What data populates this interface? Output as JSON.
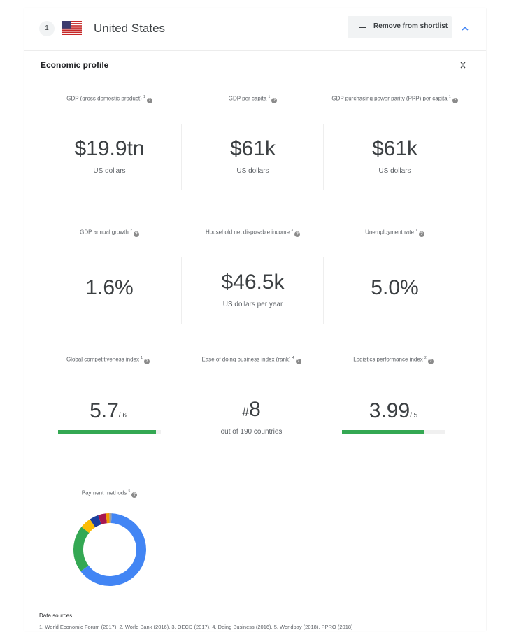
{
  "header": {
    "rank": "1",
    "country": "United States",
    "remove_label": "Remove from shortlist"
  },
  "section": {
    "title": "Economic profile"
  },
  "metrics": {
    "gdp": {
      "label": "GDP (gross domestic product)",
      "sup": "1",
      "value": "$19.9tn",
      "unit": "US dollars"
    },
    "gdp_per_capita": {
      "label": "GDP per capita",
      "sup": "1",
      "value": "$61k",
      "unit": "US dollars"
    },
    "gdp_ppp": {
      "label": "GDP purchasing power parity (PPP) per capita",
      "sup": "1",
      "value": "$61k",
      "unit": "US dollars"
    },
    "gdp_growth": {
      "label": "GDP annual growth",
      "sup": "2",
      "value": "1.6%"
    },
    "household_income": {
      "label": "Household net disposable income",
      "sup": "3",
      "value": "$46.5k",
      "unit": "US dollars per year"
    },
    "unemployment": {
      "label": "Unemployment rate",
      "sup": "1",
      "value": "5.0%"
    },
    "competitiveness": {
      "label": "Global competitiveness index",
      "sup": "1",
      "value": "5.7",
      "denominator": "/ 6",
      "fraction": 0.95
    },
    "ease_business": {
      "label": "Ease of doing business index (rank)",
      "sup": "4",
      "hash": "#",
      "value": "8",
      "unit": "out of 190 countries"
    },
    "logistics": {
      "label": "Logistics performance index",
      "sup": "2",
      "value": "3.99",
      "denominator": "/ 5",
      "fraction": 0.8
    },
    "payment": {
      "label": "Payment methods",
      "sup": "5"
    }
  },
  "payment_segments": [
    {
      "share": 0.64,
      "color": "#4285f4"
    },
    {
      "share": 0.21,
      "color": "#34a853"
    },
    {
      "share": 0.05,
      "color": "#fbbc04"
    },
    {
      "share": 0.04,
      "color": "#1a3f9e"
    },
    {
      "share": 0.035,
      "color": "#a8164f"
    },
    {
      "share": 0.015,
      "color": "#f29900"
    },
    {
      "share": 0.01,
      "color": "#9e9e9e"
    }
  ],
  "sources": {
    "title": "Data sources",
    "text": "1. World Economic Forum (2017), 2. World Bank (2016), 3. OECD (2017), 4. Doing Business (2016), 5. Worldpay (2018), PPRO (2018)"
  },
  "colors": {
    "accent_blue": "#4285f4",
    "bar_green": "#34a853"
  },
  "icons": {
    "flag": "us-flag-icon",
    "remove": "minus-icon",
    "expand": "chevron-up-icon",
    "collapse": "collapse-icon",
    "help": "help-icon"
  }
}
